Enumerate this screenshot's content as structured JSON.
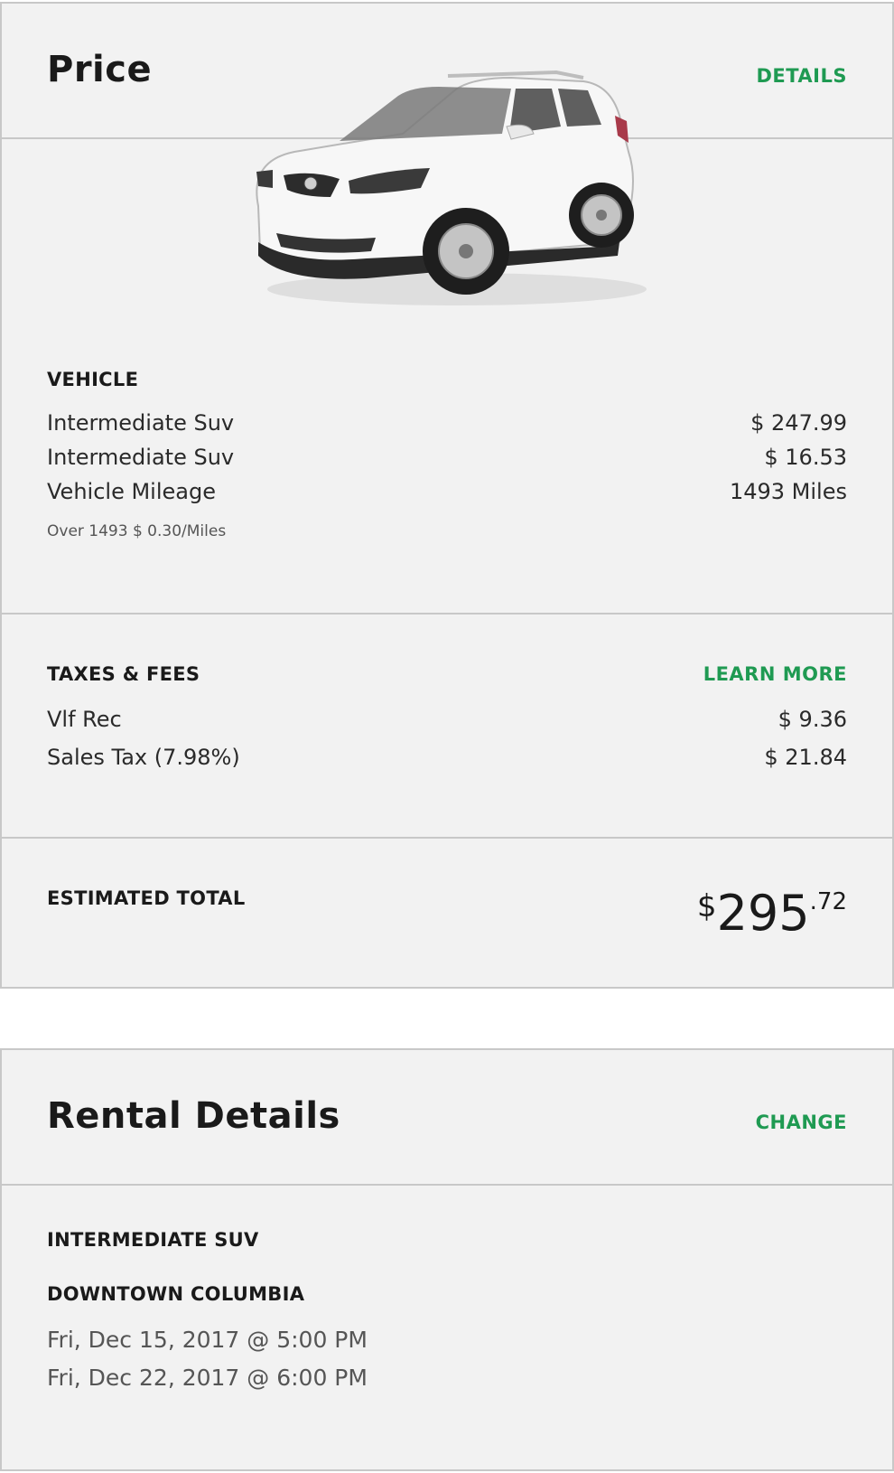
{
  "price": {
    "title": "Price",
    "details_link": "DETAILS",
    "vehicle": {
      "heading": "VEHICLE",
      "lines": [
        {
          "label": "Intermediate Suv",
          "value": "$ 247.99"
        },
        {
          "label": "Intermediate Suv",
          "value": "$ 16.53"
        },
        {
          "label": "Vehicle Mileage",
          "value": "1493 Miles"
        }
      ],
      "mileage_note": "Over 1493 $ 0.30/Miles"
    },
    "taxes": {
      "heading": "TAXES & FEES",
      "learn_more": "LEARN MORE",
      "lines": [
        {
          "label": "Vlf Rec",
          "value": "$ 9.36"
        },
        {
          "label": "Sales Tax (7.98%)",
          "value": "$ 21.84"
        }
      ]
    },
    "total": {
      "heading": "ESTIMATED TOTAL",
      "symbol": "$",
      "whole": "295",
      "cents": ".72"
    }
  },
  "rental": {
    "title": "Rental Details",
    "change_link": "CHANGE",
    "vehicle_class": "INTERMEDIATE SUV",
    "location": "DOWNTOWN COLUMBIA",
    "pickup": "Fri, Dec 15, 2017 @ 5:00 PM",
    "dropoff": "Fri, Dec 22, 2017 @ 6:00 PM"
  },
  "colors": {
    "accent": "#1f9a52",
    "card_bg": "#f2f2f2",
    "border": "#c8c8c8",
    "car_body": "#f7f7f7"
  },
  "images": {
    "car": "white-suv-image"
  }
}
